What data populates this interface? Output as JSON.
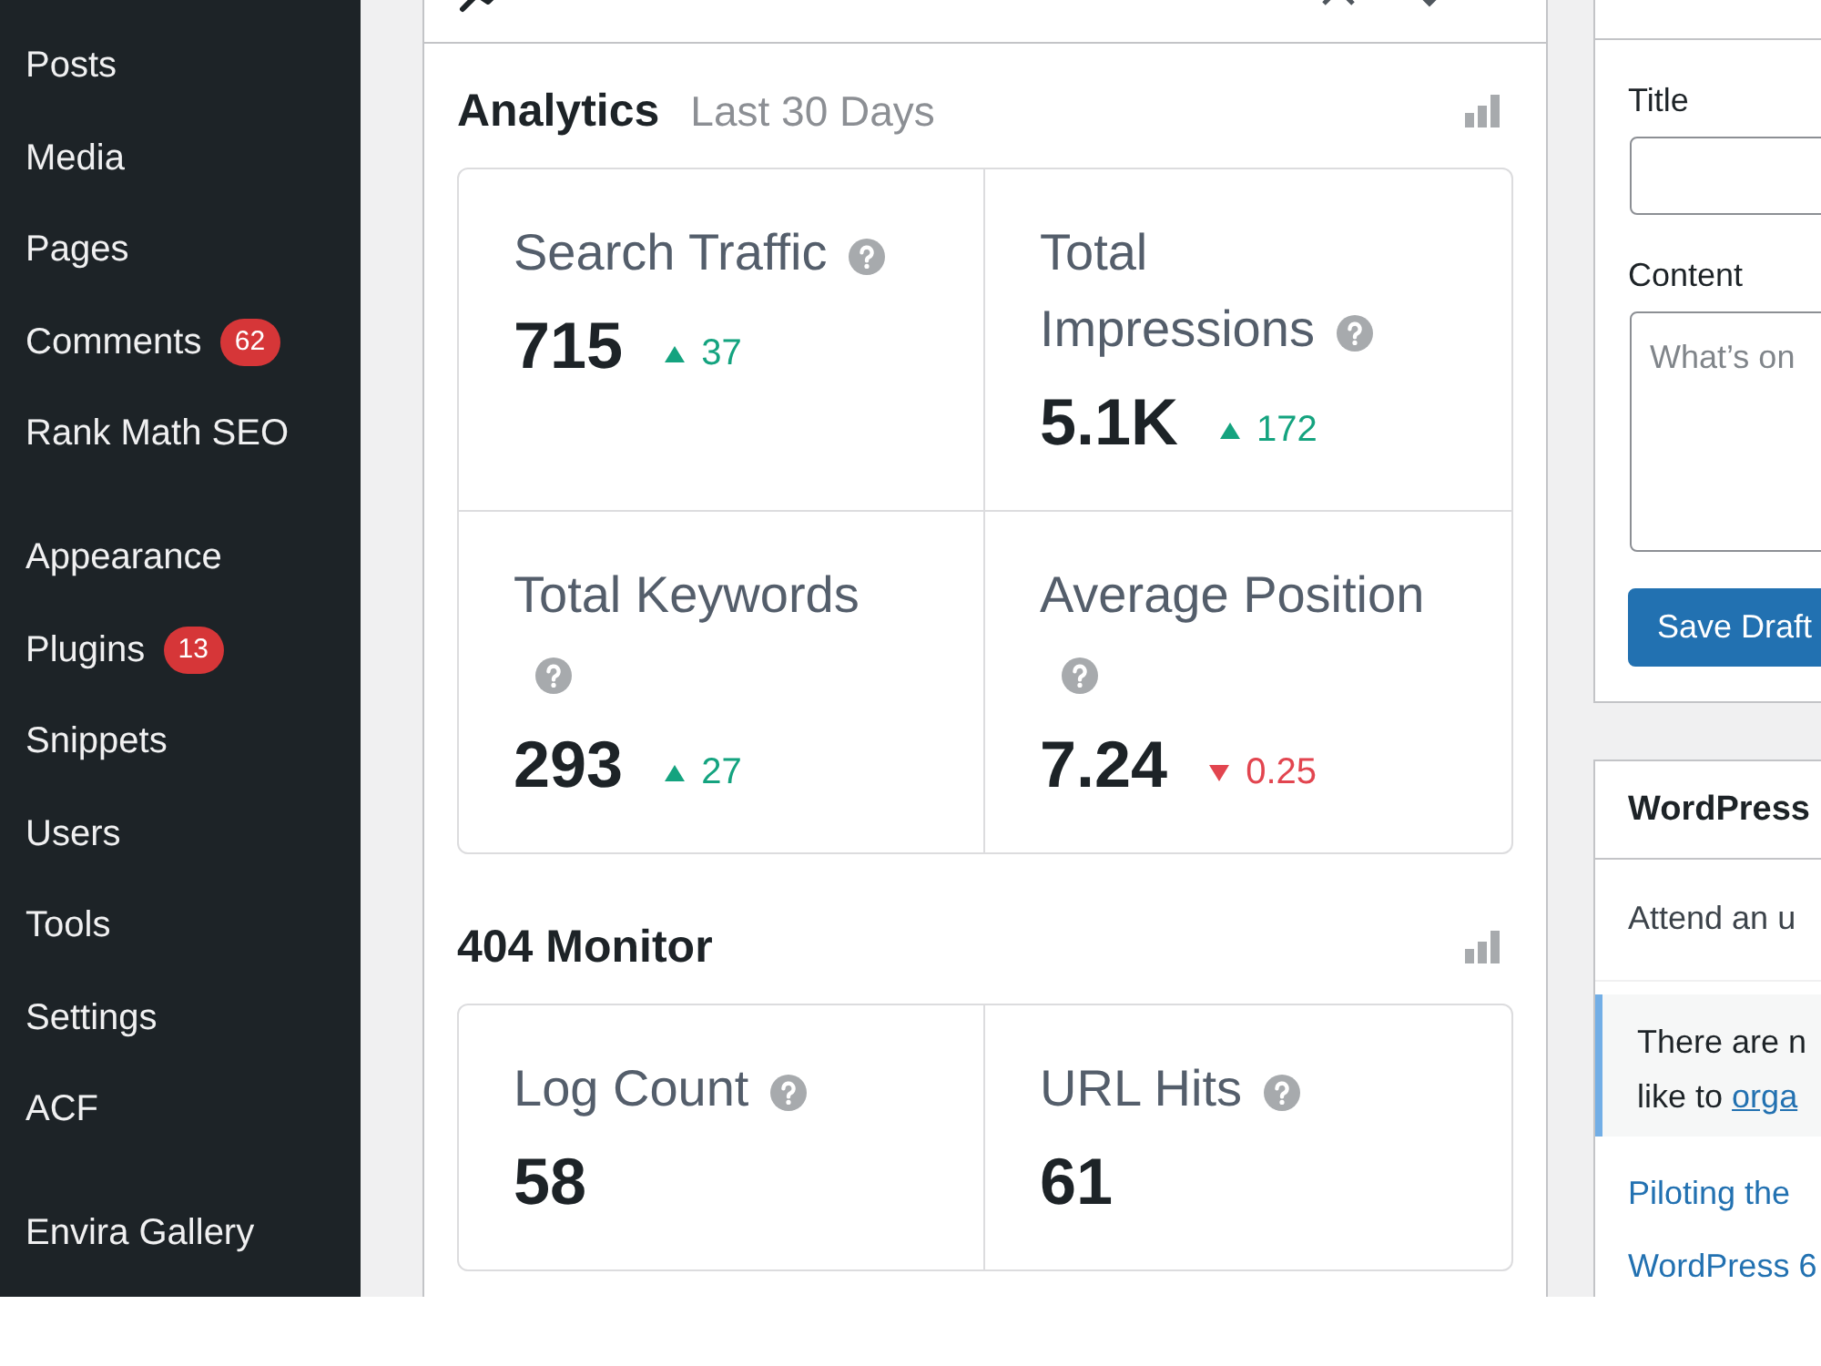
{
  "sidebar": {
    "groups": [
      {
        "items": [
          {
            "label": "Posts",
            "selected": false
          },
          {
            "label": "Media",
            "selected": false
          },
          {
            "label": "Pages",
            "selected": false
          },
          {
            "label": "Comments",
            "badge": "62",
            "selected": false
          },
          {
            "label": "Rank Math SEO",
            "selected": false
          }
        ]
      },
      {
        "items": [
          {
            "label": "Appearance",
            "selected": false
          },
          {
            "label": "Plugins",
            "badge": "13",
            "selected": false
          },
          {
            "label": "Snippets",
            "selected": false
          },
          {
            "label": "Users",
            "selected": false
          },
          {
            "label": "Tools",
            "selected": false
          },
          {
            "label": "Settings",
            "selected": false
          },
          {
            "label": "ACF",
            "selected": false
          }
        ]
      },
      {
        "items": [
          {
            "label": "Envira Gallery",
            "selected": false
          }
        ]
      }
    ]
  },
  "overview_panel": {
    "sections": [
      {
        "title": "Analytics",
        "subtitle": "Last 30 Days",
        "stats": [
          {
            "kind": "rise",
            "label": "Search Traffic",
            "value": "715",
            "change": "37"
          },
          {
            "kind": "rise",
            "label": "Total Impressions",
            "value": "5.1K",
            "change": "172"
          },
          {
            "kind": "rise",
            "label": "Total Keywords",
            "value": "293",
            "change": "27"
          },
          {
            "kind": "fall",
            "label": "Average Position",
            "value": "7.24",
            "change": "0.25"
          }
        ]
      },
      {
        "title": "404 Monitor",
        "stats": [
          {
            "kind": "plain",
            "label": "Log Count",
            "value": "58"
          },
          {
            "kind": "plain",
            "label": "URL Hits",
            "value": "61"
          }
        ]
      }
    ]
  },
  "quick_draft": {
    "fields": [
      {
        "kind": "input",
        "label": "Title"
      },
      {
        "kind": "textarea",
        "label": "Content",
        "placeholder": "What’s on"
      }
    ],
    "button": "Save Draft"
  },
  "events_panel": {
    "title": "WordPress",
    "intro": "Attend an u",
    "notice": {
      "lines": [
        "There are n",
        "like to"
      ],
      "link": "orga"
    },
    "links": [
      "Piloting the",
      "WordPress 6"
    ]
  }
}
